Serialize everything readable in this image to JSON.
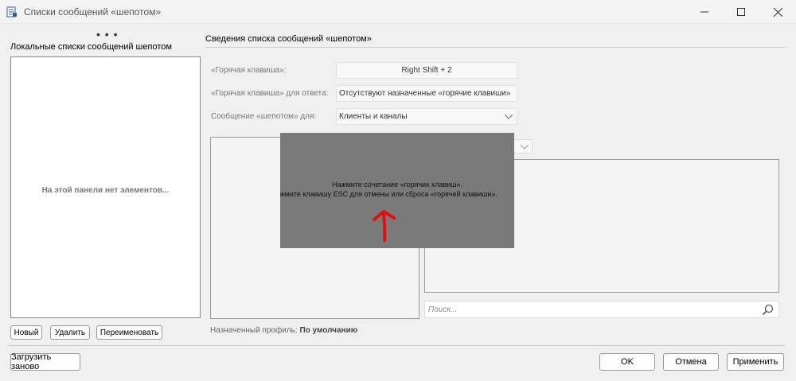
{
  "window": {
    "title": "Списки сообщений «шепотом»",
    "icon": "app-list-icon",
    "controls": [
      "minimize-icon",
      "maximize-icon",
      "close-icon"
    ]
  },
  "left": {
    "grip": "• • •",
    "heading": "Локальные списки сообщений шепотом",
    "empty_text": "На этой панели нет элементов...",
    "buttons": {
      "new": "Новый",
      "delete": "Удалить",
      "rename": "Переименовать"
    }
  },
  "right": {
    "heading": "Сведения списка сообщений «шепотом»",
    "hotkey_label": "«Горячая клавиша»:",
    "hotkey_value": "Right Shift + 2",
    "reply_hotkey_label": "«Горячая клавиша» для ответа:",
    "reply_hotkey_value": "Отсутствуют назначенные «горячие клавиши»",
    "whisper_for_label": "Сообщение «шепотом» для:",
    "whisper_for_value": "Клиенты и каналы",
    "search_placeholder": "Поиск...",
    "profile_label": "Назначенный профиль:",
    "profile_value": "По умолчанию"
  },
  "overlay": {
    "line1": "Нажмите сочетание «горячих клавиш».",
    "line2": "Нажмите клавишу ESC для отмены или сброса «горячей клавиши»."
  },
  "footer": {
    "reload": "Загрузить заново",
    "ok": "OK",
    "cancel": "Отмена",
    "apply": "Применить"
  },
  "colors": {
    "overlay_bg": "#7a7a7a",
    "annotation_arrow": "#e01010"
  }
}
